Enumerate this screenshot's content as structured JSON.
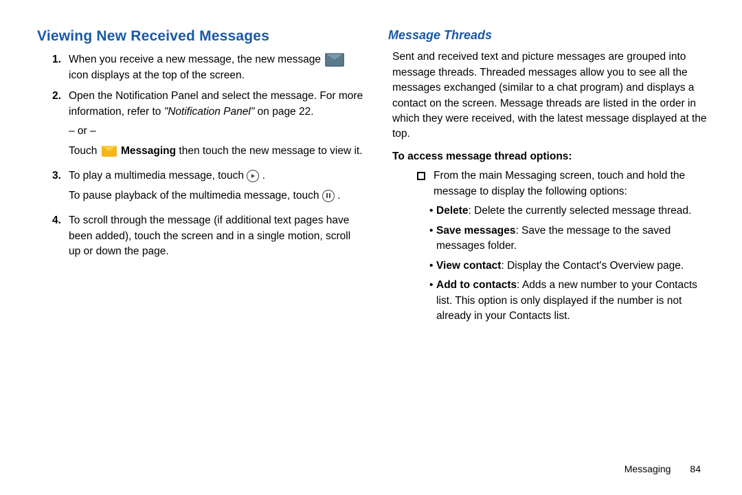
{
  "left": {
    "heading": "Viewing New Received Messages",
    "step1a": "When you receive a new message, the new message",
    "step1b": " icon displays at the top of the screen.",
    "step2a": "Open the Notification Panel and select the message. For more information, refer to ",
    "step2ref": "\"Notification Panel\"",
    "step2b": " on page 22.",
    "or": "– or –",
    "step2c1": "Touch ",
    "step2c2": " Messaging",
    "step2c3": " then touch the new message to view it.",
    "step3a": "To play a multimedia message, touch ",
    "step3b": "To pause playback of the multimedia message, touch ",
    "step4": "To scroll through the message (if additional text pages have been added), touch the screen and in a single motion, scroll up or down the page.",
    "n1": "1.",
    "n2": "2.",
    "n3": "3.",
    "n4": "4."
  },
  "right": {
    "subheading": "Message Threads",
    "intro": "Sent and received text and picture messages are grouped into message threads. Threaded messages allow you to see all the messages exchanged (similar to a chat program) and displays a contact on the screen. Message threads are listed in the order in which they were received, with the latest message displayed at the top.",
    "access": "To access message thread options:",
    "square": "From the main Messaging screen, touch and hold the message to display the following options:",
    "b1a": "Delete",
    "b1b": ": Delete the currently selected message thread.",
    "b2a": "Save messages",
    "b2b": ": Save the message to the saved messages folder.",
    "b3a": "View contact",
    "b3b": ": Display the Contact's Overview page.",
    "b4a": "Add to contacts",
    "b4b": ": Adds a new number to your Contacts list. This option is only displayed if the number is not already in your Contacts list."
  },
  "footer": {
    "section": "Messaging",
    "page": "84"
  }
}
